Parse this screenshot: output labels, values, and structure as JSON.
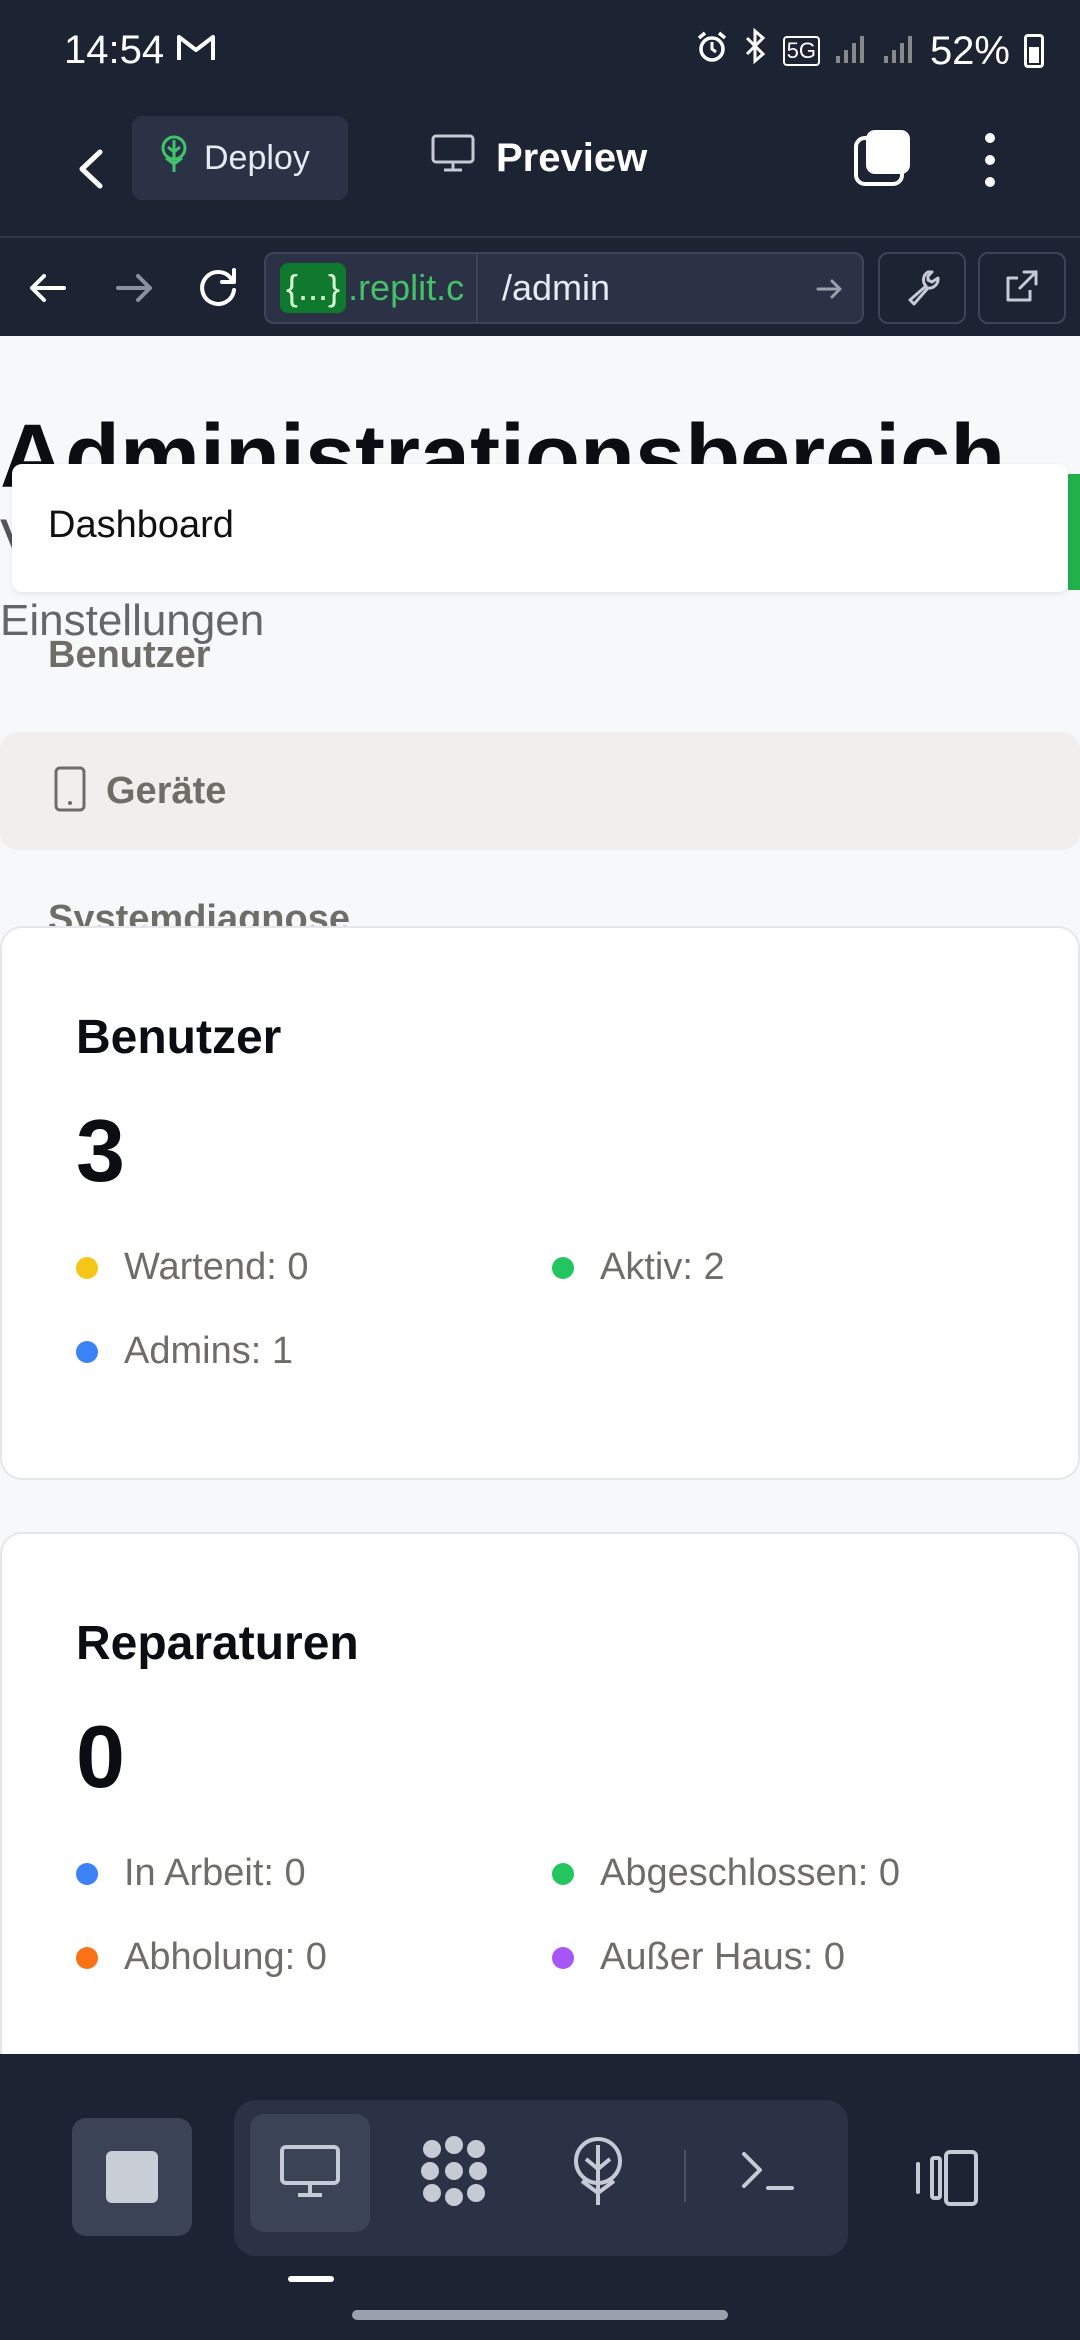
{
  "status_bar": {
    "time": "14:54",
    "mail_icon": "gmail-icon",
    "network": "5G",
    "battery": "52%"
  },
  "header": {
    "deploy_label": "Deploy",
    "preview_label": "Preview"
  },
  "browser": {
    "url_host": ".replit.c",
    "url_tag": "{...}",
    "url_path": "/admin"
  },
  "page": {
    "title": "Administrationsbereich",
    "subtitle_initial": "V",
    "menu_item": "Dashboard",
    "settings_label": "Einstellungen",
    "nav_users": "Benutzer",
    "nav_devices": "Geräte",
    "nav_diagnostics": "Systemdiagnose"
  },
  "cards": {
    "users": {
      "title": "Benutzer",
      "count": "3",
      "waiting": "Wartend: 0",
      "active": "Aktiv: 2",
      "admins": "Admins: 1"
    },
    "repairs": {
      "title": "Reparaturen",
      "count": "0",
      "in_progress": "In Arbeit: 0",
      "completed": "Abgeschlossen: 0",
      "pickup": "Abholung: 0",
      "out_of_house": "Außer Haus: 0"
    }
  },
  "colors": {
    "yellow": "#f5c518",
    "green": "#22c55e",
    "blue": "#3b82f6",
    "orange": "#f97316",
    "purple": "#a855f7",
    "app_bg": "#1c2333"
  }
}
